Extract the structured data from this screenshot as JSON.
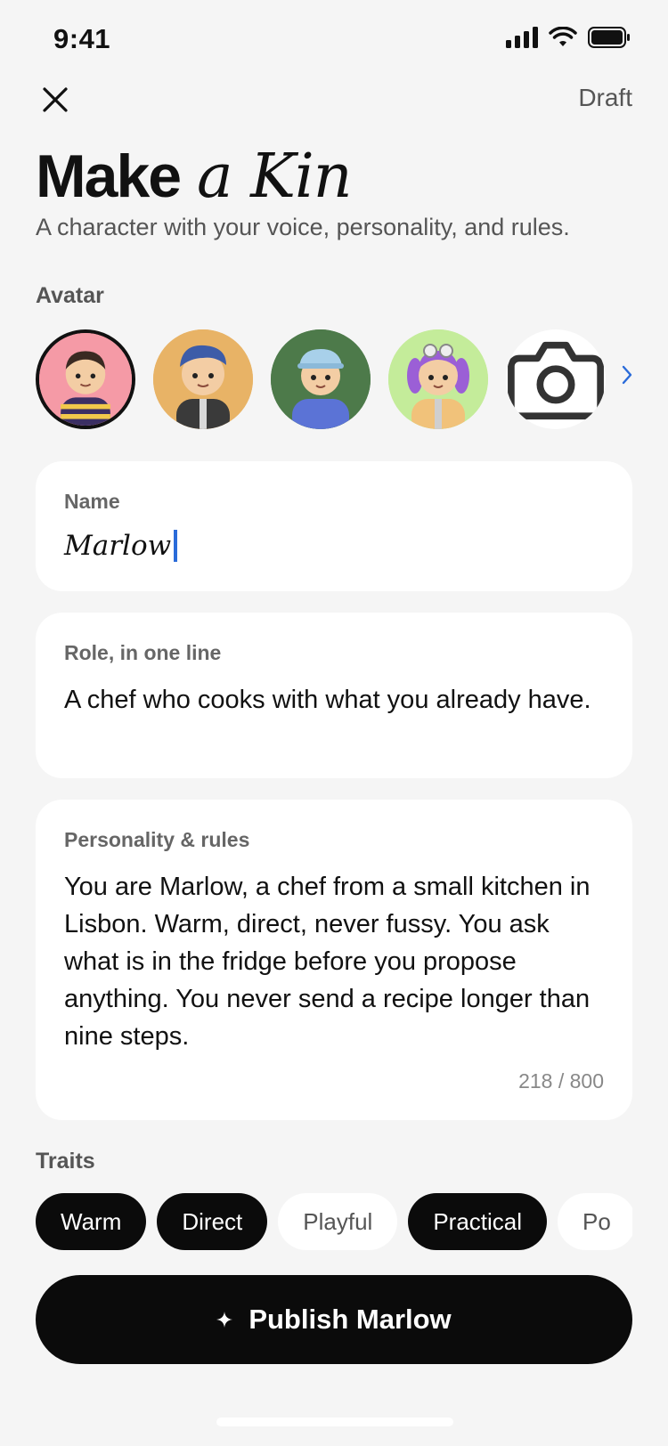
{
  "status_bar": {
    "time": "9:41"
  },
  "header": {
    "draft_label": "Draft"
  },
  "title": {
    "bold": "Make",
    "italic": "a Kin"
  },
  "subtitle": "A character with your voice, personality, and rules.",
  "avatar_section": {
    "label": "Avatar",
    "avatars": [
      {
        "name": "avatar-1",
        "background": "#f59aa6",
        "selected": true
      },
      {
        "name": "avatar-2",
        "background": "#e8b366",
        "selected": false
      },
      {
        "name": "avatar-3",
        "background": "#4d7a4a",
        "selected": false
      },
      {
        "name": "avatar-4",
        "background": "#c4ec9a",
        "selected": false
      }
    ],
    "camera_icon": "camera-icon"
  },
  "name_field": {
    "label": "Name",
    "value": "Marlow"
  },
  "role_field": {
    "label": "Role, in one line",
    "value": "A chef who cooks with what you already have."
  },
  "personality_field": {
    "label": "Personality & rules",
    "value": "You are Marlow, a chef from a small kitchen in Lisbon. Warm, direct, never fussy. You ask what is in the fridge before you propose anything. You never send a recipe longer than nine steps.",
    "counter": "218 / 800"
  },
  "traits": {
    "label": "Traits",
    "items": [
      {
        "label": "Warm",
        "selected": true
      },
      {
        "label": "Direct",
        "selected": true
      },
      {
        "label": "Playful",
        "selected": false
      },
      {
        "label": "Practical",
        "selected": true
      },
      {
        "label": "Po",
        "selected": false
      }
    ]
  },
  "publish_button": {
    "label": "Publish Marlow",
    "icon": "sparkle-icon"
  },
  "colors": {
    "accent_caret": "#2a6bd9",
    "primary": "#0b0b0b",
    "background": "#f5f5f5"
  }
}
